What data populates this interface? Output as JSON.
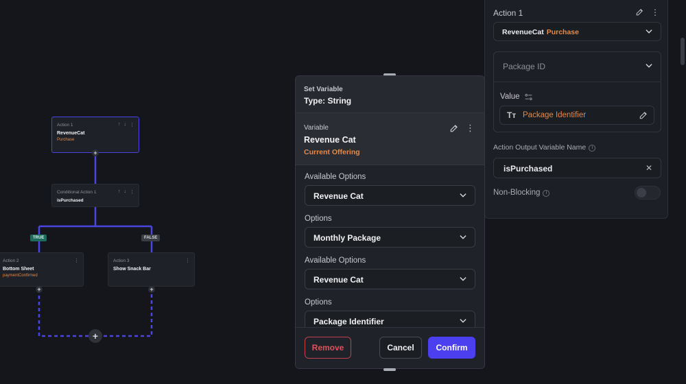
{
  "flow": {
    "action1": {
      "title": "Action 1",
      "name": "RevenueCat",
      "sub": "Purchase"
    },
    "conditional": {
      "title": "Conditional Action 1",
      "name": "isPurchased"
    },
    "branch_true": "TRUE",
    "branch_false": "FALSE",
    "action2": {
      "title": "Action 2",
      "name": "Bottom Sheet",
      "sub": "paymentConfirmed"
    },
    "action3": {
      "title": "Action 3",
      "name": "Show Snack Bar"
    },
    "add_symbol": "+"
  },
  "right_panel": {
    "action_title": "Action 1",
    "action_type": "RevenueCat",
    "action_subtype": "Purchase",
    "package_id_label": "Package ID",
    "value_label": "Value",
    "value_type_glyph": "Tт",
    "value_text": "Package Identifier",
    "output_label": "Action Output Variable Name",
    "output_value": "isPurchased",
    "non_blocking_label": "Non-Blocking",
    "info_glyph": "i"
  },
  "modal": {
    "header_label": "Set Variable",
    "header_type": "Type: String",
    "variable_label": "Variable",
    "variable_name": "Revenue Cat",
    "variable_current": "Current Offering",
    "options": [
      {
        "label": "Available Options",
        "value": "Revenue Cat"
      },
      {
        "label": "Options",
        "value": "Monthly Package"
      },
      {
        "label": "Available Options",
        "value": "Revenue Cat"
      },
      {
        "label": "Options",
        "value": "Package Identifier"
      }
    ],
    "remove_label": "Remove",
    "cancel_label": "Cancel",
    "confirm_label": "Confirm"
  },
  "colors": {
    "accent_orange": "#e58a4a",
    "primary_purple": "#4b3ff0",
    "danger_red": "#e0515c",
    "flow_line": "#4b45e0",
    "true_badge": "#1f6b5e"
  },
  "icons": {
    "edit": "pencil-icon",
    "more": "more-vertical-icon",
    "chevron": "chevron-down-icon",
    "clear": "close-icon",
    "settings": "sliders-icon"
  }
}
